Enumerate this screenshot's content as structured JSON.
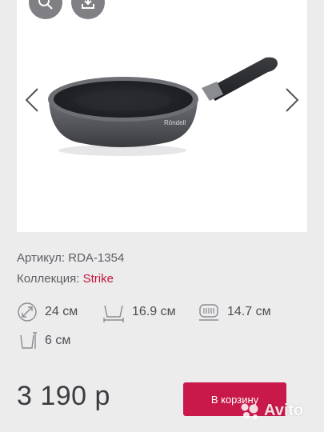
{
  "gallery": {
    "zoom_icon": "magnifier-icon",
    "download_icon": "download-icon",
    "prev_icon": "chevron-left-icon",
    "next_icon": "chevron-right-icon",
    "product_image": "frying-pan-photo",
    "brand_on_pan": "Röndell"
  },
  "info": {
    "article_label": "Артикул:",
    "article_value": "RDA-1354",
    "collection_label": "Коллекция:",
    "collection_value": "Strike"
  },
  "specs": {
    "diameter": "24 см",
    "bottom_diameter": "16.9 см",
    "induction_diameter": "14.7 см",
    "height": "6 см"
  },
  "price": "3 190 р",
  "cart_button": "В корзину",
  "watermark": "Avito",
  "colors": {
    "accent": "#c8194a",
    "link": "#c2143c",
    "background": "#ececed"
  }
}
